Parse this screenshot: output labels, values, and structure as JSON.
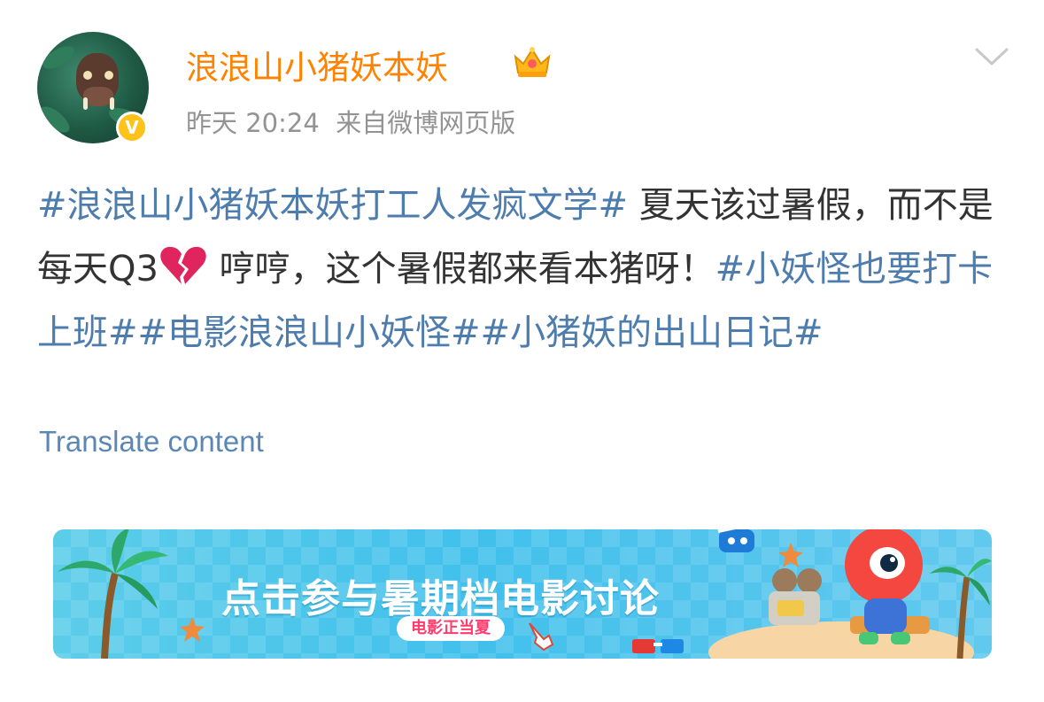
{
  "user": {
    "name": "浪浪山小猪妖本妖",
    "verified_badge": "V",
    "crown_icon": "crown-icon"
  },
  "meta": {
    "time": "昨天 20:24",
    "source": "来自微博网页版"
  },
  "post": {
    "tag1": "#浪浪山小猪妖本妖打工人发疯文学#",
    "text1": " 夏天该过暑假，而不是每天Q3",
    "emoji": "broken-heart-icon",
    "text2": " 哼哼，这个暑假都来看本猪呀！",
    "tag2": "#小妖怪也要打卡上班#",
    "tag3": "#电影浪浪山小妖怪#",
    "tag4": "#小猪妖的出山日记#"
  },
  "translate_label": "Translate content",
  "banner": {
    "title": "点击参与暑期档电影讨论",
    "tag": "电影正当夏"
  },
  "colors": {
    "username": "#ff8200",
    "hashtag": "#4d7cad",
    "meta": "#939393",
    "banner": "#41c0ec"
  }
}
